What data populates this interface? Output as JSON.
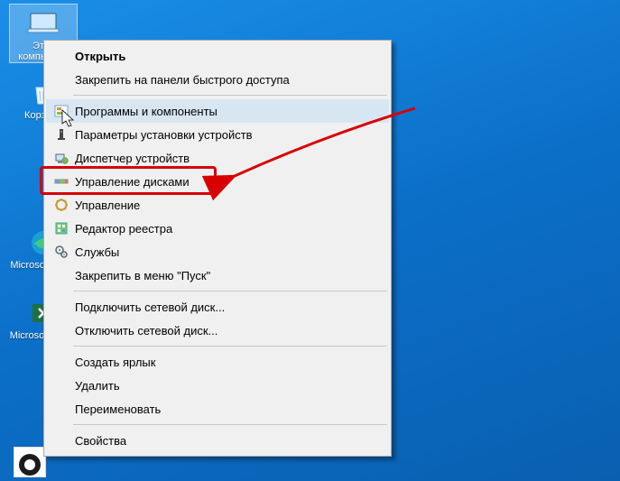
{
  "desktop": {
    "icons": [
      {
        "label": "Этот\nкомпьютер"
      },
      {
        "label": "Корзина"
      },
      {
        "label": "Microsoft\nEdge"
      },
      {
        "label": "Microsoft\nExcel"
      }
    ]
  },
  "context_menu": {
    "groups": [
      [
        {
          "label": "Открыть",
          "icon": null,
          "bold": true
        },
        {
          "label": "Закрепить на панели быстрого доступа",
          "icon": null
        }
      ],
      [
        {
          "label": "Программы и компоненты",
          "icon": "programs-icon",
          "hover": true
        },
        {
          "label": "Параметры установки устройств",
          "icon": "device-settings-icon"
        },
        {
          "label": "Диспетчер устройств",
          "icon": "device-manager-icon"
        },
        {
          "label": "Управление дисками",
          "icon": "disk-management-icon",
          "highlight": true
        },
        {
          "label": "Управление",
          "icon": "management-icon"
        },
        {
          "label": "Редактор реестра",
          "icon": "registry-icon"
        },
        {
          "label": "Службы",
          "icon": "services-icon"
        },
        {
          "label": "Закрепить в меню \"Пуск\"",
          "icon": null
        }
      ],
      [
        {
          "label": "Подключить сетевой диск...",
          "icon": null
        },
        {
          "label": "Отключить сетевой диск...",
          "icon": null
        }
      ],
      [
        {
          "label": "Создать ярлык",
          "icon": null
        },
        {
          "label": "Удалить",
          "icon": null
        },
        {
          "label": "Переименовать",
          "icon": null
        }
      ],
      [
        {
          "label": "Свойства",
          "icon": null
        }
      ]
    ]
  },
  "annotation": {
    "highlight_color": "#d80000"
  }
}
